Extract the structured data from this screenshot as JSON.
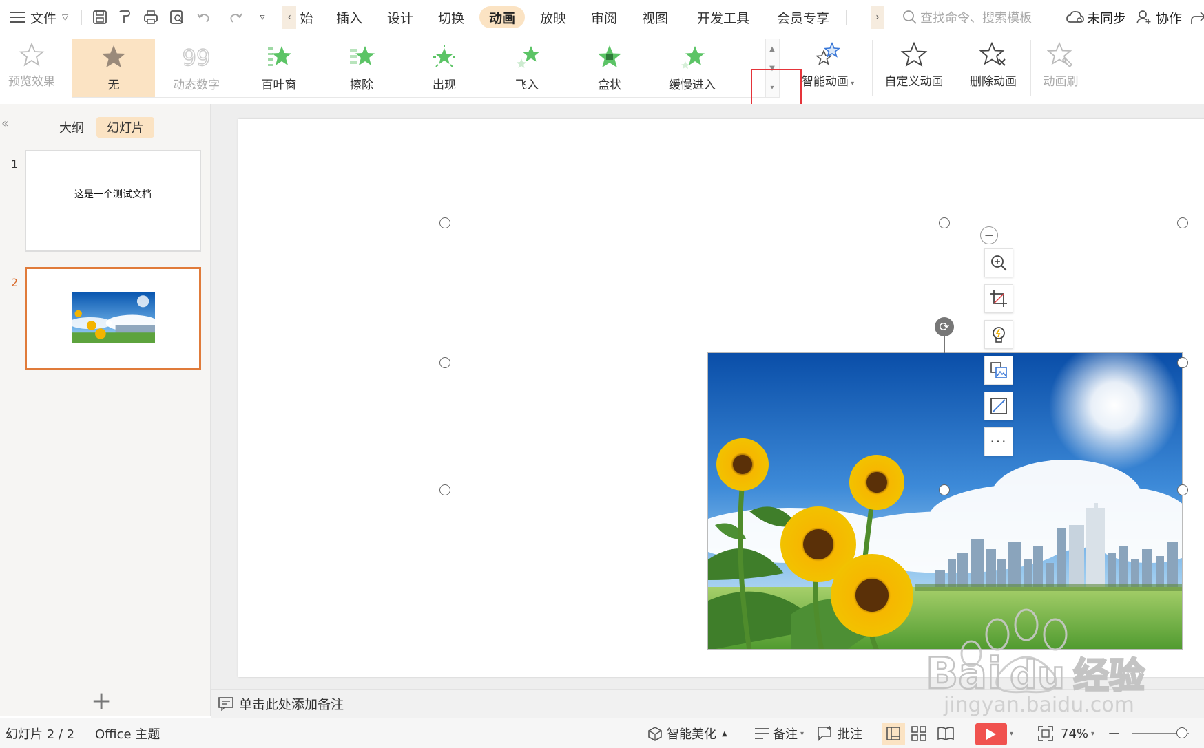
{
  "menubar": {
    "file_label": "文件",
    "tabs": [
      {
        "label": "始",
        "active": false
      },
      {
        "label": "插入",
        "active": false
      },
      {
        "label": "设计",
        "active": false
      },
      {
        "label": "切换",
        "active": false
      },
      {
        "label": "动画",
        "active": true
      },
      {
        "label": "放映",
        "active": false
      },
      {
        "label": "审阅",
        "active": false
      },
      {
        "label": "视图",
        "active": false
      },
      {
        "label": "开发工具",
        "active": false
      },
      {
        "label": "会员专享",
        "active": false
      }
    ],
    "search_placeholder": "查找命令、搜索模板",
    "sync_label": "未同步",
    "collab_label": "协作"
  },
  "ribbon": {
    "preview_label": "预览效果",
    "effects": [
      {
        "label": "无",
        "icon": "star-none-icon",
        "selected": true,
        "disabled": false
      },
      {
        "label": "动态数字",
        "icon": "dynamic-number-icon",
        "selected": false,
        "disabled": true
      },
      {
        "label": "百叶窗",
        "icon": "blinds-star-icon",
        "selected": false,
        "disabled": false
      },
      {
        "label": "擦除",
        "icon": "wipe-star-icon",
        "selected": false,
        "disabled": false
      },
      {
        "label": "出现",
        "icon": "appear-star-icon",
        "selected": false,
        "disabled": false
      },
      {
        "label": "飞入",
        "icon": "fly-in-star-icon",
        "selected": false,
        "disabled": false
      },
      {
        "label": "盒状",
        "icon": "box-star-icon",
        "selected": false,
        "disabled": false
      },
      {
        "label": "缓慢进入",
        "icon": "crawl-in-star-icon",
        "selected": false,
        "disabled": false
      }
    ],
    "smart_anim_label": "智能动画",
    "custom_anim_label": "自定义动画",
    "delete_anim_label": "删除动画",
    "anim_brush_label": "动画刷"
  },
  "leftpane": {
    "tab_outline": "大纲",
    "tab_slides": "幻灯片",
    "slides": [
      {
        "number": "1",
        "title": "这是一个测试文档",
        "active": false
      },
      {
        "number": "2",
        "title": "",
        "active": true
      }
    ],
    "add_label": "+"
  },
  "notes": {
    "placeholder": "单击此处添加备注"
  },
  "statusbar": {
    "slide_info": "幻灯片 2 / 2",
    "theme": "Office 主题",
    "beautify": "智能美化",
    "notes": "备注",
    "comments": "批注",
    "zoom": "74%"
  },
  "watermark": {
    "brand": "Bai",
    "brand_cn": "经验",
    "url": "jingyan.baidu.com"
  },
  "colors": {
    "accent": "#fbe3c3",
    "active_slide_border": "#e07b3a",
    "highlight_box": "#e5343a",
    "play_button": "#f0524f",
    "star_green": "#5cc466"
  }
}
